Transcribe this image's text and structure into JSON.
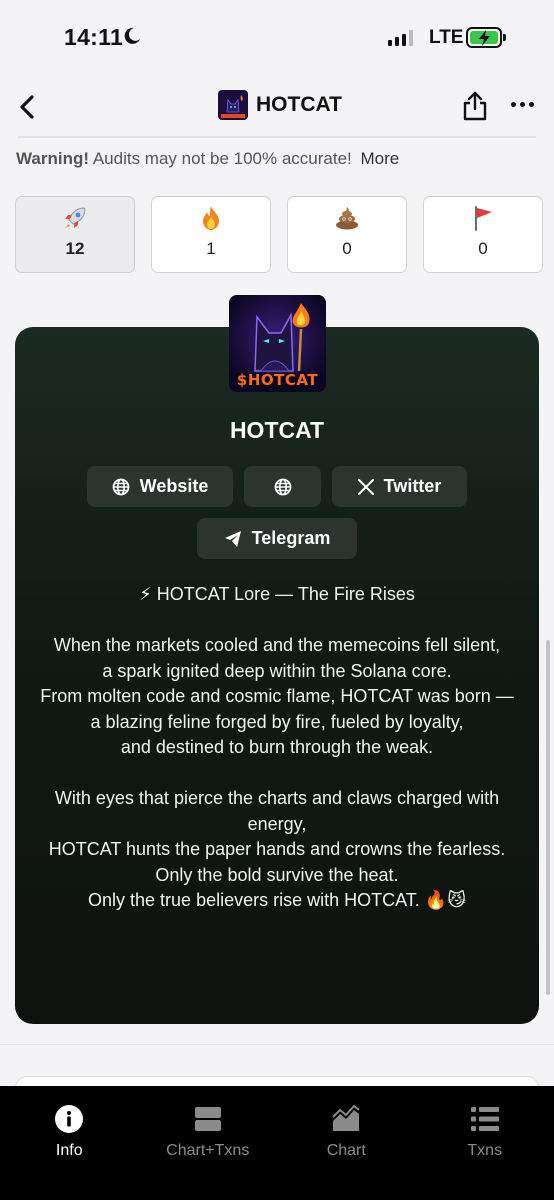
{
  "status_bar": {
    "time": "14:11",
    "network": "LTE"
  },
  "nav": {
    "title": "HOTCAT"
  },
  "warning": {
    "label": "Warning!",
    "text": "Audits may not be 100% accurate!",
    "more": "More"
  },
  "reactions": [
    {
      "icon": "rocket-icon",
      "count": "12"
    },
    {
      "icon": "fire-icon",
      "count": "1"
    },
    {
      "icon": "poop-icon",
      "count": "0"
    },
    {
      "icon": "flag-icon",
      "count": "0"
    }
  ],
  "token": {
    "logo_text": "$HOTCAT",
    "name": "HOTCAT",
    "links": {
      "website": "Website",
      "twitter": "Twitter",
      "telegram": "Telegram"
    }
  },
  "lore": [
    "⚡ HOTCAT Lore — The Fire Rises",
    "",
    "When the markets cooled and the memecoins fell silent,",
    "a spark ignited deep within the Solana core.",
    "From molten code and cosmic flame, HOTCAT was born —",
    "a blazing feline forged by fire, fueled by loyalty,",
    "and destined to burn through the weak.",
    "",
    "With eyes that pierce the charts and claws charged with energy,",
    "HOTCAT hunts the paper hands and crowns the fearless.",
    "Only the bold survive the heat.",
    "Only the true believers rise with HOTCAT. 🔥😼"
  ],
  "tabs": [
    {
      "label": "Info",
      "icon": "info-icon"
    },
    {
      "label": "Chart+Txns",
      "icon": "split-view-icon"
    },
    {
      "label": "Chart",
      "icon": "area-chart-icon"
    },
    {
      "label": "Txns",
      "icon": "list-icon"
    }
  ],
  "colors": {
    "card_bg": "#121a15",
    "button_bg": "#2d3430",
    "tab_bar_bg": "#000000",
    "battery": "#39c64a"
  }
}
